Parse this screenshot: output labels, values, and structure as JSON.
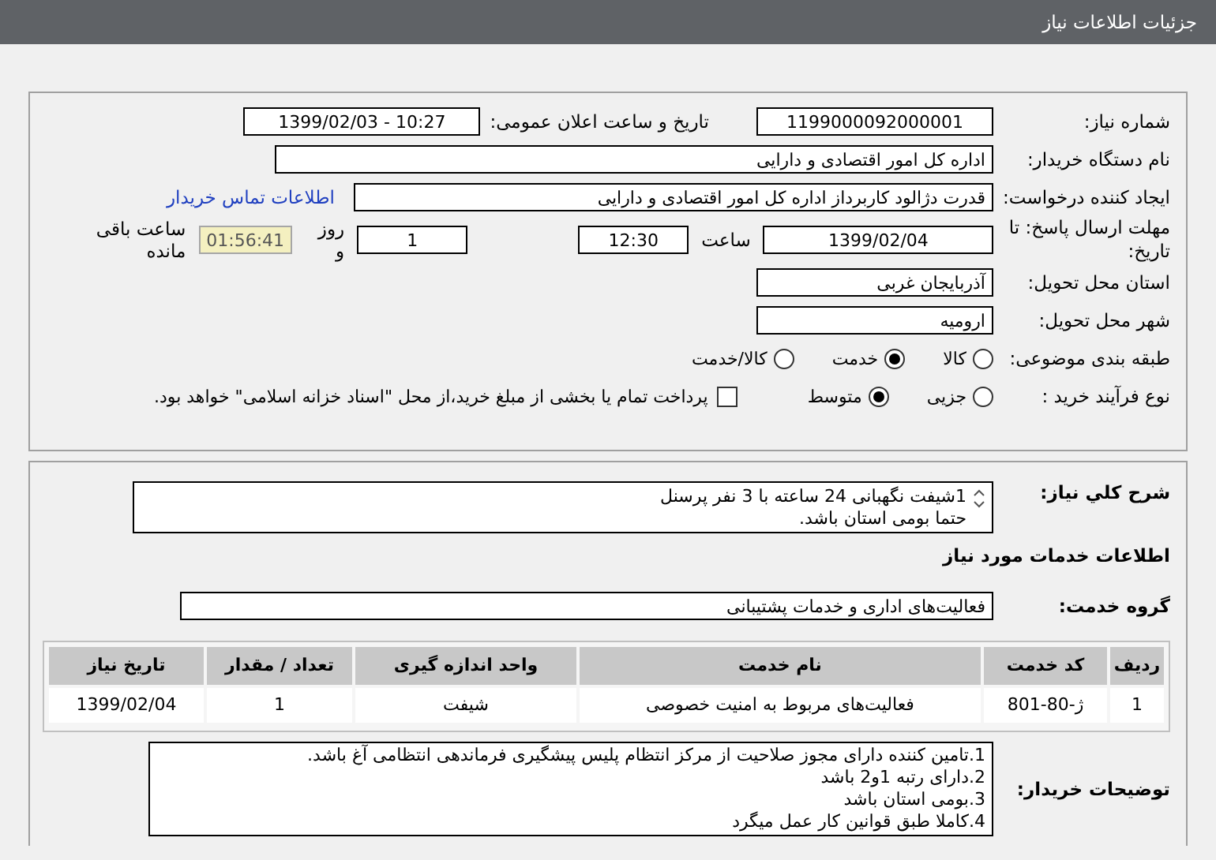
{
  "header": {
    "title": "جزئیات اطلاعات نیاز"
  },
  "need_number": {
    "label": "شماره نیاز:",
    "value": "1199000092000001"
  },
  "announce": {
    "label": "تاریخ و ساعت اعلان عمومی:",
    "value": "1399/02/03 - 10:27"
  },
  "buyer_org": {
    "label": "نام دستگاه خریدار:",
    "value": "اداره کل امور اقتصادی و دارایی"
  },
  "requester": {
    "label": "ایجاد کننده درخواست:",
    "value": "قدرت دژالود کاربرداز اداره کل امور اقتصادی و دارایی",
    "link": "اطلاعات تماس خریدار"
  },
  "deadline": {
    "label": "مهلت ارسال پاسخ: تا تاریخ:",
    "date": "1399/02/04",
    "time_label": "ساعت",
    "time": "12:30",
    "days": "1",
    "days_label": "روز و",
    "remaining": "01:56:41",
    "remaining_label": "ساعت باقی مانده"
  },
  "province": {
    "label": "استان محل تحویل:",
    "value": "آذربایجان غربی"
  },
  "city": {
    "label": "شهر محل تحویل:",
    "value": "ارومیه"
  },
  "category": {
    "label": "طبقه بندی موضوعی:",
    "options": [
      {
        "label": "کالا",
        "selected": false
      },
      {
        "label": "خدمت",
        "selected": true
      },
      {
        "label": "کالا/خدمت",
        "selected": false
      }
    ]
  },
  "process": {
    "label": "نوع فرآیند خرید :",
    "options": [
      {
        "label": "جزیی",
        "selected": false
      },
      {
        "label": "متوسط",
        "selected": true
      }
    ],
    "payment": {
      "label": "پرداخت تمام یا بخشی از مبلغ خرید،از محل \"اسناد خزانه اسلامی\" خواهد بود.",
      "checked": false
    }
  },
  "description": {
    "label": "شرح کلي نیاز:",
    "lines": [
      "1شیفت نگهبانی 24 ساعته با 3 نفر پرسنل",
      "حتما بومی استان باشد."
    ]
  },
  "services_heading": "اطلاعات خدمات مورد نیاز",
  "service_group": {
    "label": "گروه خدمت:",
    "value": "فعالیت‌های اداری و خدمات پشتیبانی"
  },
  "table": {
    "columns": [
      "ردیف",
      "کد خدمت",
      "نام خدمت",
      "واحد اندازه گیری",
      "تعداد / مقدار",
      "تاریخ نیاز"
    ],
    "rows": [
      [
        "1",
        "ژ-80-801",
        "فعالیت‌های مربوط به امنیت خصوصی",
        "شیفت",
        "1",
        "1399/02/04"
      ]
    ]
  },
  "buyer_notes": {
    "label": "توضیحات خریدار:",
    "lines": [
      "1.تامین کننده دارای مجوز صلاحیت از مرکز انتظام پلیس پیشگیری فرماندهی انتظامی آغ باشد.",
      "2.دارای رتبه 1و2 باشد",
      "3.بومی استان باشد",
      "4.کاملا طبق قوانین کار عمل میگرد"
    ]
  }
}
